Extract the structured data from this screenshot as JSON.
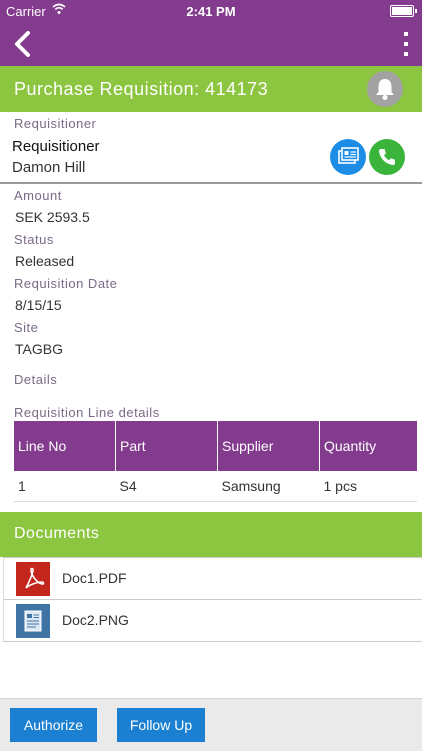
{
  "status_bar": {
    "carrier": "Carrier",
    "time": "2:41 PM"
  },
  "navbar": {
    "back_icon": "chevron-left-icon",
    "more_icon": "vertical-dots-icon"
  },
  "title_bar": {
    "title": "Purchase Requisition: 414173",
    "bell_icon": "bell-icon"
  },
  "requisitioner": {
    "section_label": "Requisitioner",
    "name_label": "Requisitioner",
    "name": "Damon Hill",
    "contact_icon": "contact-card-icon",
    "phone_icon": "phone-icon",
    "contact_color": "#1b8de6",
    "phone_color": "#3ab43a"
  },
  "fields": {
    "amount_label": "Amount",
    "amount": "SEK 2593.5",
    "status_label": "Status",
    "status": "Released",
    "date_label": "Requisition Date",
    "date": "8/15/15",
    "site_label": "Site",
    "site": "TAGBG",
    "details_label": "Details"
  },
  "lines": {
    "section_label": "Requisition Line details",
    "headers": [
      "Line No",
      "Part",
      "Supplier",
      "Quantity"
    ],
    "rows": [
      [
        "1",
        "S4",
        "Samsung",
        "1 pcs"
      ]
    ]
  },
  "documents": {
    "header": "Documents",
    "items": [
      {
        "name": "Doc1.PDF",
        "icon": "pdf-icon"
      },
      {
        "name": "Doc2.PNG",
        "icon": "image-document-icon"
      }
    ]
  },
  "footer": {
    "authorize_label": "Authorize",
    "follow_up_label": "Follow Up"
  },
  "colors": {
    "purple": "#833b8d",
    "green": "#8cc53f",
    "blue_button": "#1b7fd2"
  }
}
